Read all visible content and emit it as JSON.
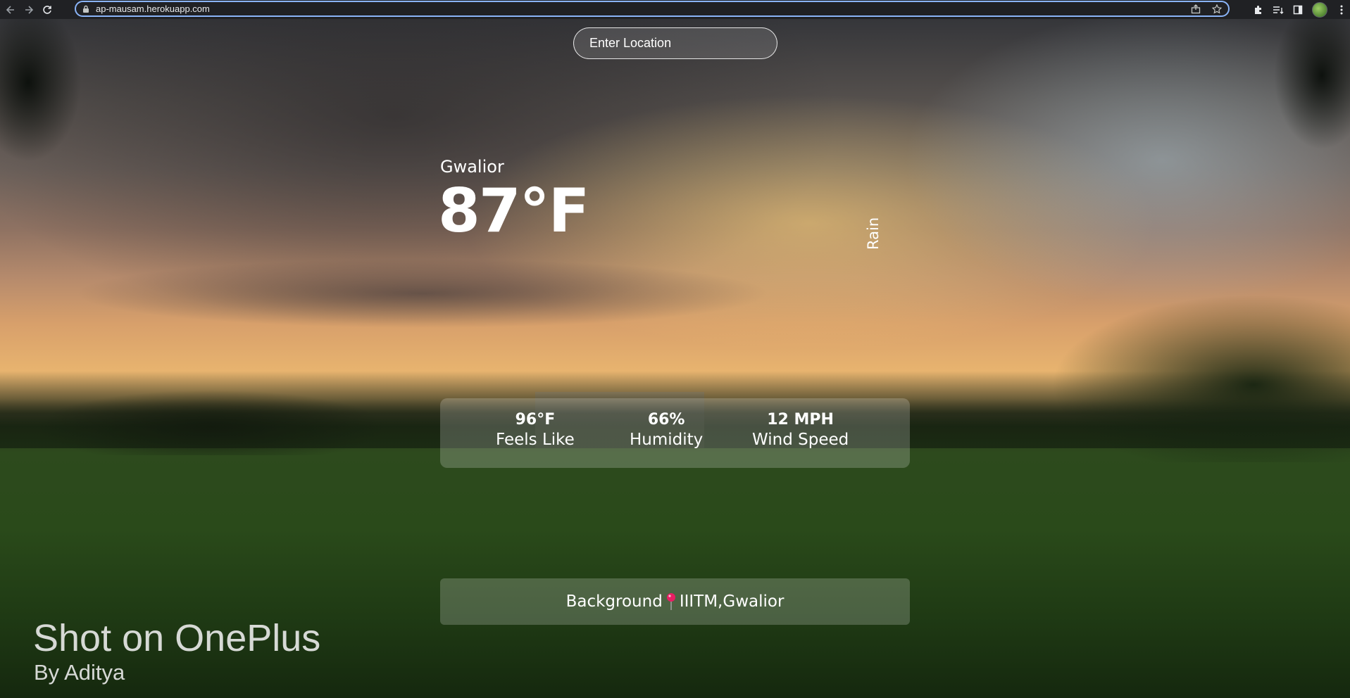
{
  "browser": {
    "url": "ap-mausam.herokuapp.com",
    "icons": [
      "back-icon",
      "forward-icon",
      "reload-icon",
      "lock-icon",
      "share-icon",
      "star-icon",
      "extensions-icon",
      "reading-list-icon",
      "side-panel-icon",
      "avatar",
      "menu-icon"
    ]
  },
  "search": {
    "placeholder": "Enter Location"
  },
  "weather": {
    "city": "Gwalior",
    "temperature": "87°F",
    "condition": "Rain"
  },
  "stats": [
    {
      "value": "96°F",
      "label": "Feels Like"
    },
    {
      "value": "66%",
      "label": "Humidity"
    },
    {
      "value": "12 MPH",
      "label": "Wind Speed"
    }
  ],
  "background_info": {
    "prefix": "Background",
    "place": "IIITM,Gwalior",
    "pin_color": "#e91e63"
  },
  "credit": {
    "title": "Shot on OnePlus",
    "author": "By Aditya"
  }
}
